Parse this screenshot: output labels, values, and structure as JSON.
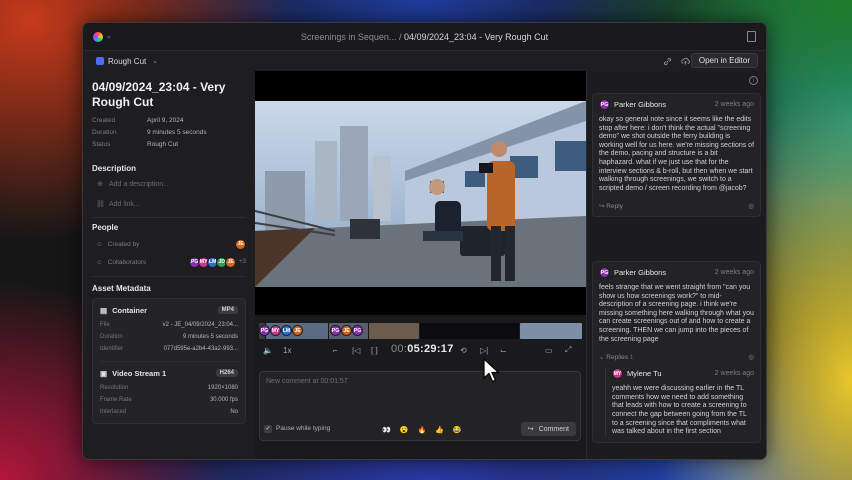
{
  "breadcrumb": {
    "parent": "Screenings in Sequen...",
    "separator": "/",
    "current": "04/09/2024_23:04 - Very Rough Cut"
  },
  "toolbar": {
    "status_chip": "Rough Cut",
    "open_editor": "Open in Editor"
  },
  "asset": {
    "title": "04/09/2024_23:04 - Very Rough Cut",
    "meta": [
      {
        "key": "Created",
        "value": "April 9, 2024"
      },
      {
        "key": "Duration",
        "value": "9 minutes 5 seconds"
      },
      {
        "key": "Status",
        "value": "Rough Cut"
      }
    ]
  },
  "description": {
    "heading": "Description",
    "add_description": "Add a description...",
    "add_link": "Add link..."
  },
  "people": {
    "heading": "People",
    "created_by_label": "Created by",
    "collaborators_label": "Collaborators",
    "creator": "JE",
    "collaborators": [
      "PG",
      "MY",
      "LM",
      "JD",
      "JE"
    ],
    "more": "+3"
  },
  "metadata": {
    "heading": "Asset Metadata",
    "container": {
      "label": "Container",
      "badge": "MP4",
      "rows": [
        {
          "key": "File",
          "value": "v2 - JE_04/09/2024_23:04..."
        },
        {
          "key": "Duration",
          "value": "9 minutes 5 seconds"
        },
        {
          "key": "Identifier",
          "value": "077d595e-a2b4-43a2-993..."
        }
      ]
    },
    "video_stream": {
      "label": "Video Stream 1",
      "badge": "H264",
      "rows": [
        {
          "key": "Resolution",
          "value": "1920×1080"
        },
        {
          "key": "Frame Rate",
          "value": "30.000 fps"
        },
        {
          "key": "Interlaced",
          "value": "No"
        }
      ]
    }
  },
  "player": {
    "speed": "1x",
    "timecode_dim": "00:",
    "timecode": "05:29:17"
  },
  "comment_box": {
    "placeholder": "New comment at 00:01:57",
    "pause_label": "Pause while typing",
    "emojis": [
      "👀",
      "😮",
      "🔥",
      "👍",
      "😂"
    ],
    "send_label": "Comment"
  },
  "comments": [
    {
      "initials": "PG",
      "name": "Parker Gibbons",
      "time": "2 weeks ago",
      "body": "okay so general note since it seems like the edits stop after here: i don't think the actual \"screening demo\" we shot outside the ferry building is working well for us here. we're missing sections of the demo, pacing and structure is a bit haphazard. what if we just use that for the interview sections & b-roll, but then when we start walking through screenings, we switch to a scripted demo / screen recording from @jacob?",
      "reply_label": "Reply"
    },
    {
      "initials": "PG",
      "name": "Parker Gibbons",
      "time": "2 weeks ago",
      "body": "feels strange that we went straight from \"can you show us how screenings work?\" to mid-description of a screening page. i think we're missing something here walking through what you can create screenings out of and how to create a screening. THEN we can jump into the pieces of the screening page",
      "replies_label": "Replies",
      "replies_count": "1",
      "reply": {
        "initials": "MY",
        "name": "Mylene Tu",
        "time": "2 weeks ago",
        "body": "yeahh we were discussing earlier in the TL comments how we need to add something that leads with how to create a screening to connect the gap between going from the TL to a screening since that compliments what was talked about in the first section"
      }
    }
  ],
  "colors": {
    "accent": "#4a6cf7",
    "avatar_pg": "#8b2fb5",
    "avatar_my": "#c7368f",
    "avatar_lm": "#2f6fcf",
    "avatar_jd": "#2d9c56",
    "avatar_je": "#d4651c"
  }
}
